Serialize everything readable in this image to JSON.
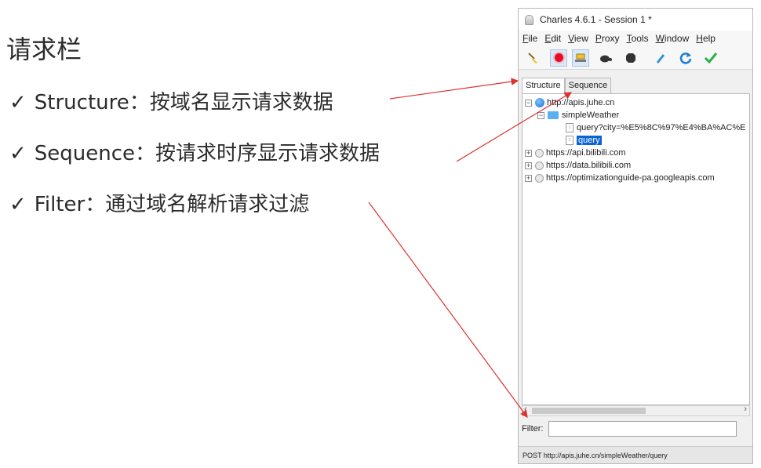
{
  "slide": {
    "title": "请求栏",
    "check": "✓",
    "bullets": [
      "Structure：按域名显示请求数据",
      "Sequence：按请求时序显示请求数据",
      "Filter：通过域名解析请求过滤"
    ]
  },
  "window": {
    "title": "Charles 4.6.1 - Session 1 *",
    "menu": [
      "File",
      "Edit",
      "View",
      "Proxy",
      "Tools",
      "Window",
      "Help"
    ],
    "toolbar_icons": [
      "broom-icon",
      "record-icon",
      "throttle-icon",
      "turtle-icon",
      "stop-icon",
      "pen-icon",
      "refresh-icon",
      "check-icon"
    ],
    "tabs": [
      "Structure",
      "Sequence"
    ],
    "tree": {
      "host1": "http://apis.juhe.cn",
      "folder": "simpleWeather",
      "file1": "query?city=%E5%8C%97%E4%BA%AC%E",
      "file2": "query",
      "host2": "https://api.bilibili.com",
      "host3": "https://data.bilibili.com",
      "host4": "https://optimizationguide-pa.googleapis.com"
    },
    "filter_label": "Filter:",
    "filter_value": "",
    "status": "POST http://apis.juhe.cn/simpleWeather/query"
  },
  "colors": {
    "arrow": "#e03030",
    "selection": "#0a64d6"
  }
}
